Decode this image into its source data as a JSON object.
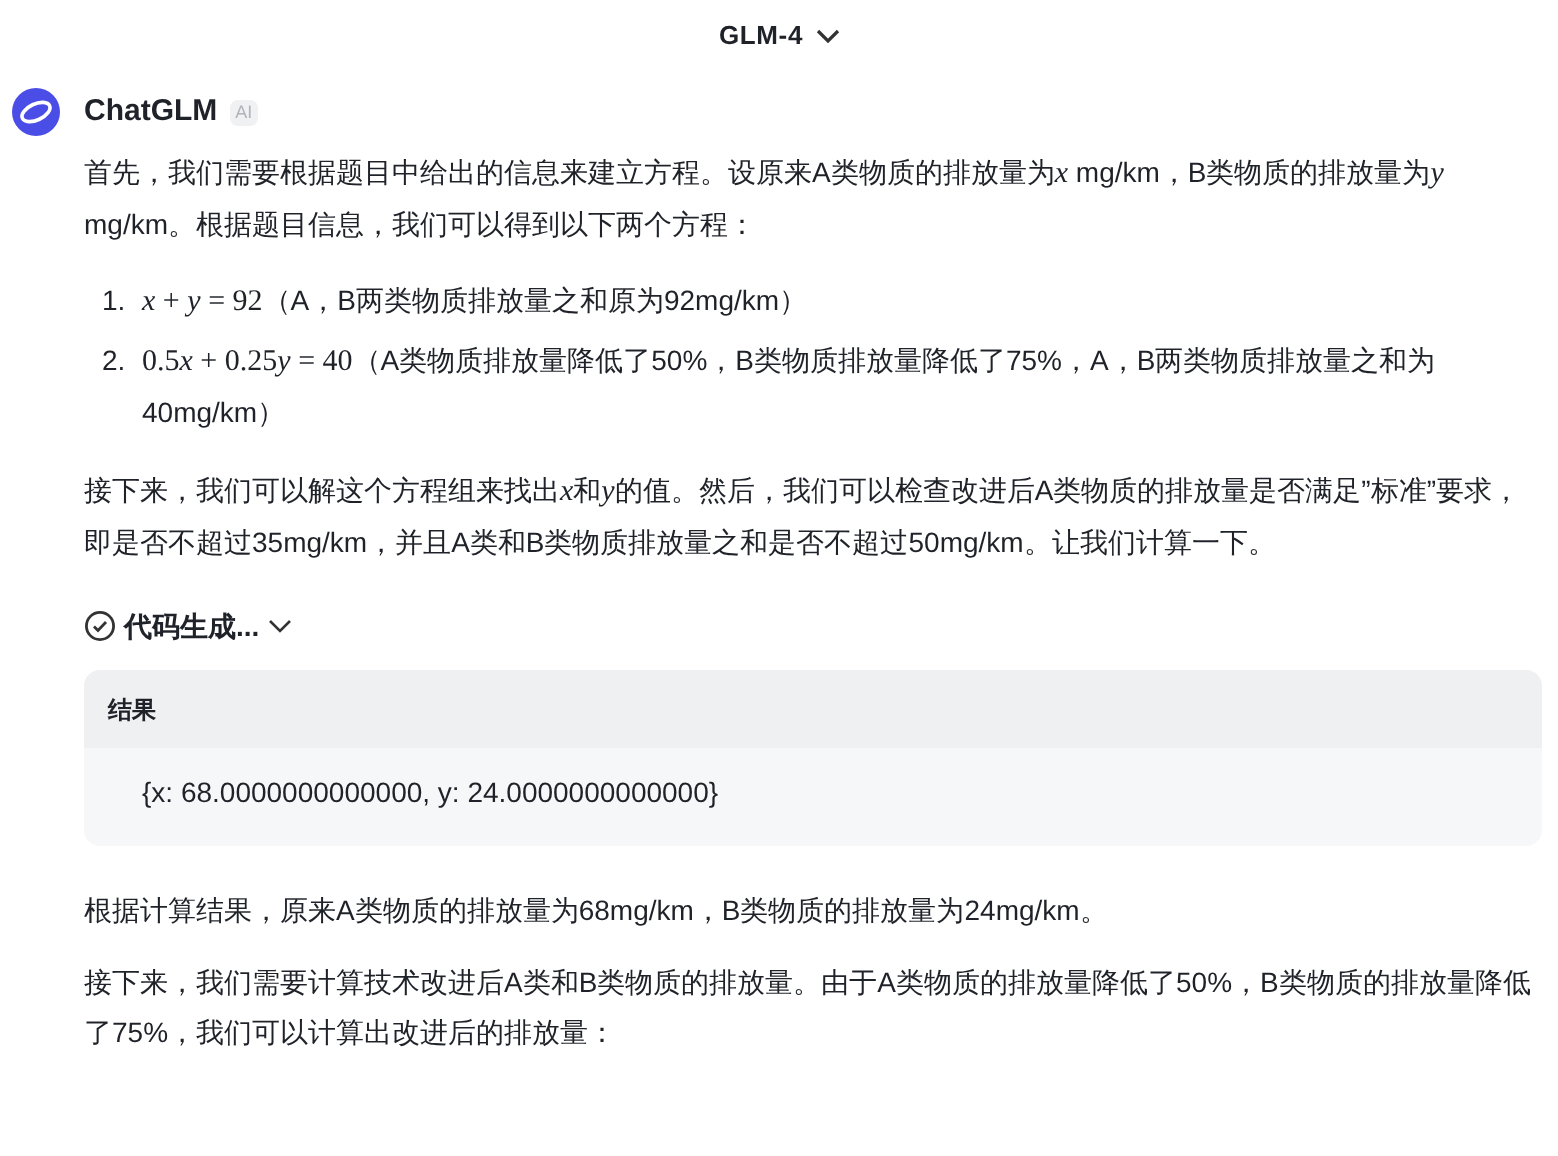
{
  "header": {
    "model": "GLM-4"
  },
  "message": {
    "sender": "ChatGLM",
    "badge": "AI",
    "intro": [
      {
        "kind": "text",
        "text": "首先，我们需要根据题目中给出的信息来建立方程。设原来A类物质的排放量为"
      },
      {
        "kind": "var",
        "text": "x"
      },
      {
        "kind": "text",
        "text": " mg/km，B类物质的排放量为"
      },
      {
        "kind": "var",
        "text": "y"
      },
      {
        "kind": "text",
        "text": " mg/km。根据题目信息，我们可以得到以下两个方程："
      }
    ],
    "equations": [
      {
        "number": "1.",
        "parts": [
          {
            "kind": "var",
            "text": "x"
          },
          {
            "kind": "math",
            "text": " + "
          },
          {
            "kind": "var",
            "text": "y"
          },
          {
            "kind": "math",
            "text": " = 92"
          },
          {
            "kind": "text",
            "text": "（A，B两类物质排放量之和原为92mg/km）"
          }
        ]
      },
      {
        "number": "2.",
        "parts": [
          {
            "kind": "math",
            "text": "0.5"
          },
          {
            "kind": "var",
            "text": "x"
          },
          {
            "kind": "math",
            "text": " + 0.25"
          },
          {
            "kind": "var",
            "text": "y"
          },
          {
            "kind": "math",
            "text": " = 40"
          },
          {
            "kind": "text",
            "text": "（A类物质排放量降低了50%，B类物质排放量降低了75%，A，B两类物质排放量之和为40mg/km）"
          }
        ]
      }
    ],
    "plan": [
      {
        "kind": "text",
        "text": "接下来，我们可以解这个方程组来找出"
      },
      {
        "kind": "var",
        "text": "x"
      },
      {
        "kind": "text",
        "text": "和"
      },
      {
        "kind": "var",
        "text": "y"
      },
      {
        "kind": "text",
        "text": "的值。然后，我们可以检查改进后A类物质的排放量是否满足”标准”要求，即是否不超过35mg/km，并且A类和B类物质排放量之和是否不超过50mg/km。让我们计算一下。"
      }
    ],
    "tool_status": "代码生成...",
    "result": {
      "title": "结果",
      "output": "{x: 68.0000000000000, y: 24.0000000000000}"
    },
    "after": [
      "根据计算结果，原来A类物质的排放量为68mg/km，B类物质的排放量为24mg/km。",
      "接下来，我们需要计算技术改进后A类和B类物质的排放量。由于A类物质的排放量降低了50%，B类物质的排放量降低了75%，我们可以计算出改进后的排放量："
    ]
  }
}
